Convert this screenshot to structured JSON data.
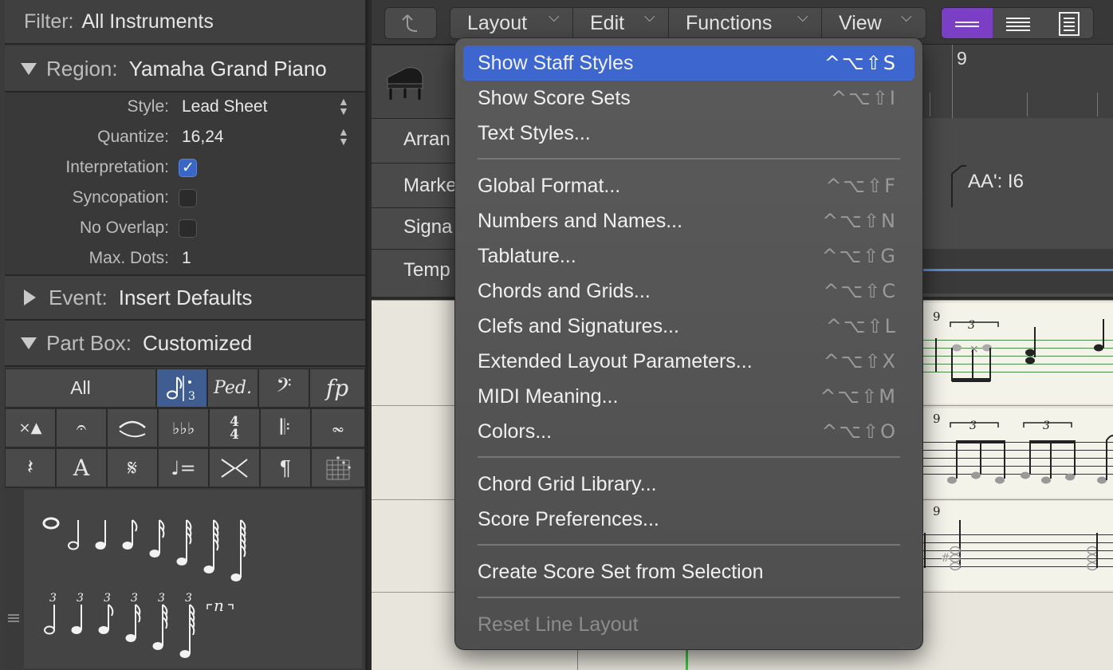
{
  "inspector": {
    "filter": {
      "label": "Filter:",
      "value": "All Instruments"
    },
    "region": {
      "label": "Region:",
      "value": "Yamaha Grand Piano"
    },
    "params": {
      "style": {
        "label": "Style:",
        "value": "Lead Sheet"
      },
      "quantize": {
        "label": "Quantize:",
        "value": "16,24"
      },
      "interpretation": {
        "label": "Interpretation:",
        "checked": true
      },
      "syncopation": {
        "label": "Syncopation:",
        "checked": false
      },
      "no_overlap": {
        "label": "No Overlap:",
        "checked": false
      },
      "max_dots": {
        "label": "Max. Dots:",
        "value": "1"
      }
    },
    "event": {
      "label": "Event:",
      "value": "Insert Defaults"
    },
    "part_box": {
      "label": "Part Box:",
      "value": "Customized",
      "all_label": "All",
      "ped": "Ped.",
      "fp": "fp",
      "text_a": "A",
      "time_sig_top": "4",
      "time_sig_bottom": "4",
      "para": "¶",
      "tuplet_label": "3",
      "rest_label": "n"
    }
  },
  "toolbar": {
    "menus": [
      {
        "label": "Layout"
      },
      {
        "label": "Edit"
      },
      {
        "label": "Functions"
      },
      {
        "label": "View"
      }
    ]
  },
  "tracks": {
    "arrange": "Arran",
    "marker": "Marke",
    "signature": "Signa",
    "tempo": "Temp",
    "ruler_bar": "9",
    "marker_value": "AA': I6",
    "measure_number": "9",
    "triplet": "3"
  },
  "layout_menu": {
    "items": [
      {
        "label": "Show Staff Styles",
        "shortcut": "^⌥⇧S",
        "highlighted": true
      },
      {
        "label": "Show Score Sets",
        "shortcut": "^⌥⇧I"
      },
      {
        "label": "Text Styles...",
        "shortcut": ""
      },
      {
        "label": "Global Format...",
        "shortcut": "^⌥⇧F"
      },
      {
        "label": "Numbers and Names...",
        "shortcut": "^⌥⇧N"
      },
      {
        "label": "Tablature...",
        "shortcut": "^⌥⇧G"
      },
      {
        "label": "Chords and Grids...",
        "shortcut": "^⌥⇧C"
      },
      {
        "label": "Clefs and Signatures...",
        "shortcut": "^⌥⇧L"
      },
      {
        "label": "Extended Layout Parameters...",
        "shortcut": "^⌥⇧X"
      },
      {
        "label": "MIDI Meaning...",
        "shortcut": "^⌥⇧M"
      },
      {
        "label": "Colors...",
        "shortcut": "^⌥⇧O"
      },
      {
        "label": "Chord Grid Library...",
        "shortcut": ""
      },
      {
        "label": "Score Preferences...",
        "shortcut": ""
      },
      {
        "label": "Create Score Set from Selection",
        "shortcut": ""
      },
      {
        "label": "Reset Line Layout",
        "shortcut": "",
        "disabled": true
      }
    ]
  },
  "colors": {
    "accent_highlight": "#3d67cf",
    "view_mode_active": "#7a3fc4",
    "checkbox_on": "#3a66c5"
  }
}
